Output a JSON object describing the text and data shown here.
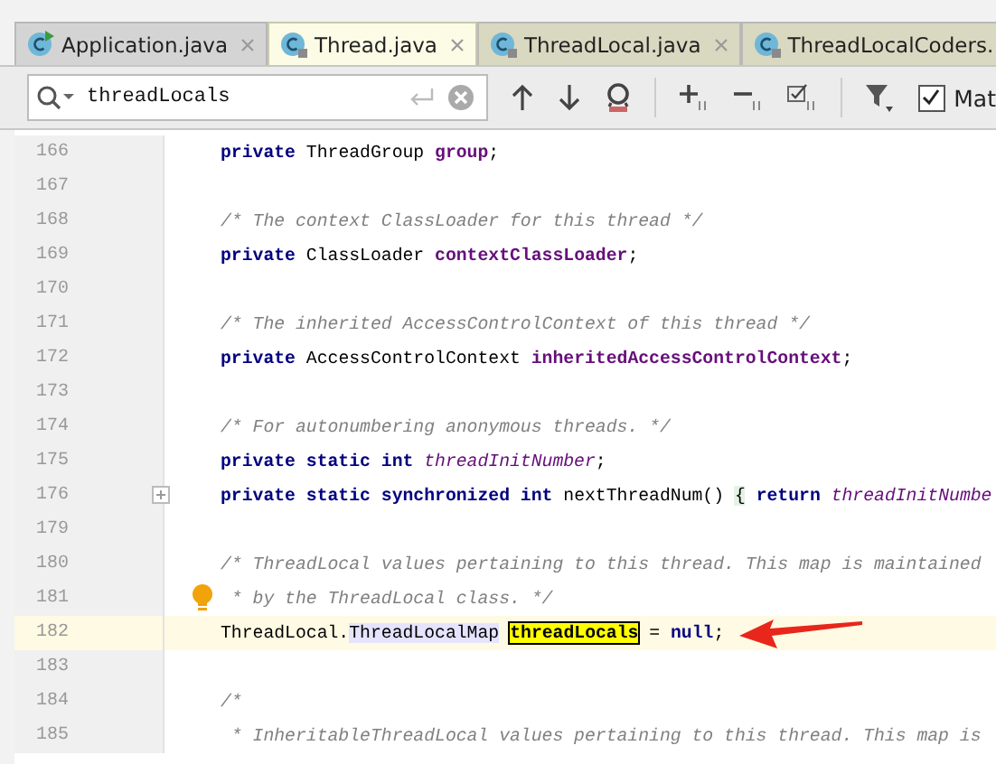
{
  "tabs": [
    {
      "label": "Application.java",
      "selected": false,
      "color": "#d4d4d4",
      "run_badge": true
    },
    {
      "label": "Thread.java",
      "selected": true,
      "color": "#fbfbe6",
      "run_badge": false
    },
    {
      "label": "ThreadLocal.java",
      "selected": false,
      "color": "#d9d8c0",
      "run_badge": false
    },
    {
      "label": "ThreadLocalCoders.",
      "selected": false,
      "color": "#d9d8c0",
      "run_badge": false
    }
  ],
  "search": {
    "value": "threadLocals"
  },
  "match_case": {
    "label": "Mat",
    "checked": true
  },
  "lines": [
    {
      "number": "166",
      "current": false,
      "foldable": false,
      "bulb": false,
      "arrow": false,
      "tokens": [
        {
          "text": "private",
          "kind": "keyword"
        },
        {
          "text": " ThreadGroup ",
          "kind": "plain"
        },
        {
          "text": "group",
          "kind": "field"
        },
        {
          "text": ";",
          "kind": "plain"
        }
      ]
    },
    {
      "number": "167",
      "current": false,
      "foldable": false,
      "bulb": false,
      "arrow": false
    },
    {
      "number": "168",
      "current": false,
      "foldable": false,
      "bulb": false,
      "arrow": false,
      "tokens": [
        {
          "text": "/* The context ClassLoader for this thread */",
          "kind": "comment"
        }
      ]
    },
    {
      "number": "169",
      "current": false,
      "foldable": false,
      "bulb": false,
      "arrow": false,
      "tokens": [
        {
          "text": "private",
          "kind": "keyword"
        },
        {
          "text": " ClassLoader ",
          "kind": "plain"
        },
        {
          "text": "contextClassLoader",
          "kind": "field"
        },
        {
          "text": ";",
          "kind": "plain"
        }
      ]
    },
    {
      "number": "170",
      "current": false,
      "foldable": false,
      "bulb": false,
      "arrow": false
    },
    {
      "number": "171",
      "current": false,
      "foldable": false,
      "bulb": false,
      "arrow": false,
      "tokens": [
        {
          "text": "/* The inherited AccessControlContext of this thread */",
          "kind": "comment"
        }
      ]
    },
    {
      "number": "172",
      "current": false,
      "foldable": false,
      "bulb": false,
      "arrow": false,
      "tokens": [
        {
          "text": "private",
          "kind": "keyword"
        },
        {
          "text": " AccessControlContext ",
          "kind": "plain"
        },
        {
          "text": "inheritedAccessControlContext",
          "kind": "field"
        },
        {
          "text": ";",
          "kind": "plain"
        }
      ]
    },
    {
      "number": "173",
      "current": false,
      "foldable": false,
      "bulb": false,
      "arrow": false
    },
    {
      "number": "174",
      "current": false,
      "foldable": false,
      "bulb": false,
      "arrow": false,
      "tokens": [
        {
          "text": "/* For autonumbering anonymous threads. */",
          "kind": "comment"
        }
      ]
    },
    {
      "number": "175",
      "current": false,
      "foldable": false,
      "bulb": false,
      "arrow": false,
      "tokens": [
        {
          "text": "private static int ",
          "kind": "keyword"
        },
        {
          "text": "threadInitNumber",
          "kind": "static_field"
        },
        {
          "text": ";",
          "kind": "plain"
        }
      ]
    },
    {
      "number": "176",
      "current": false,
      "foldable": true,
      "bulb": false,
      "arrow": false,
      "tokens": [
        {
          "text": "private static synchronized int",
          "kind": "keyword"
        },
        {
          "text": " nextThreadNum() ",
          "kind": "plain"
        },
        {
          "text": "{",
          "kind": "folded"
        },
        {
          "text": " return ",
          "kind": "keyword"
        },
        {
          "text": "threadInitNumbe",
          "kind": "static_field"
        }
      ]
    },
    {
      "number": "179",
      "current": false,
      "foldable": false,
      "bulb": false,
      "arrow": false
    },
    {
      "number": "180",
      "current": false,
      "foldable": false,
      "bulb": false,
      "arrow": false,
      "tokens": [
        {
          "text": "/* ThreadLocal values pertaining to this thread. This map is maintained",
          "kind": "comment"
        }
      ]
    },
    {
      "number": "181",
      "current": false,
      "foldable": false,
      "bulb": true,
      "arrow": false,
      "tokens": [
        {
          "text": " * by the ThreadLocal class. */",
          "kind": "comment"
        }
      ]
    },
    {
      "number": "182",
      "current": true,
      "foldable": false,
      "bulb": false,
      "arrow": true,
      "tokens": [
        {
          "text": "ThreadLocal.",
          "kind": "plain"
        },
        {
          "text": "ThreadLocalMap",
          "kind": "usage"
        },
        {
          "text": "threadLocals",
          "kind": "match"
        },
        {
          "text": " = ",
          "kind": "plain"
        },
        {
          "text": "null",
          "kind": "keyword"
        },
        {
          "text": ";",
          "kind": "plain"
        }
      ]
    },
    {
      "number": "183",
      "current": false,
      "foldable": false,
      "bulb": false,
      "arrow": false
    },
    {
      "number": "184",
      "current": false,
      "foldable": false,
      "bulb": false,
      "arrow": false,
      "tokens": [
        {
          "text": "/*",
          "kind": "comment"
        }
      ]
    },
    {
      "number": "185",
      "current": false,
      "foldable": false,
      "bulb": false,
      "arrow": false,
      "tokens": [
        {
          "text": " * InheritableThreadLocal values pertaining to this thread. This map is",
          "kind": "comment"
        }
      ]
    }
  ]
}
